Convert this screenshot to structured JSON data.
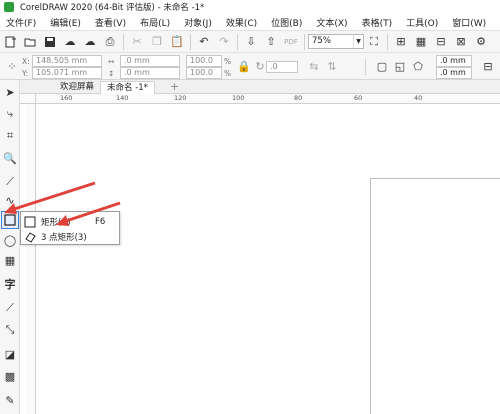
{
  "window": {
    "title": "CorelDRAW 2020 (64-Bit 评估版) - 未命名 -1*"
  },
  "menu": [
    "文件(F)",
    "编辑(E)",
    "查看(V)",
    "布局(L)",
    "对象(J)",
    "效果(C)",
    "位图(B)",
    "文本(X)",
    "表格(T)",
    "工具(O)",
    "窗口(W)"
  ],
  "toolbar": {
    "zoom": "75%"
  },
  "properties": {
    "x": "148.505 mm",
    "y": "105.071 mm",
    "w": ".0 mm",
    "h": ".0 mm",
    "scale_x": "100.0",
    "scale_y": "100.0",
    "rotation": ".0",
    "corner_1": ".0 mm",
    "corner_2": ".0 mm",
    "unit_pct": "%"
  },
  "tabs": {
    "welcome": "欢迎屏幕",
    "doc": "未命名 -1*",
    "add": "+"
  },
  "ruler": {
    "labels": [
      "160",
      "140",
      "120",
      "100",
      "80",
      "60",
      "40"
    ]
  },
  "flyout": {
    "items": [
      {
        "label": "矩形(R)",
        "shortcut": "F6"
      },
      {
        "label": "3 点矩形(3)",
        "shortcut": ""
      }
    ]
  },
  "colors": {
    "accent": "#3c7fd8",
    "arrow": "#e0413a",
    "app_icon": "#2e9e3b"
  }
}
